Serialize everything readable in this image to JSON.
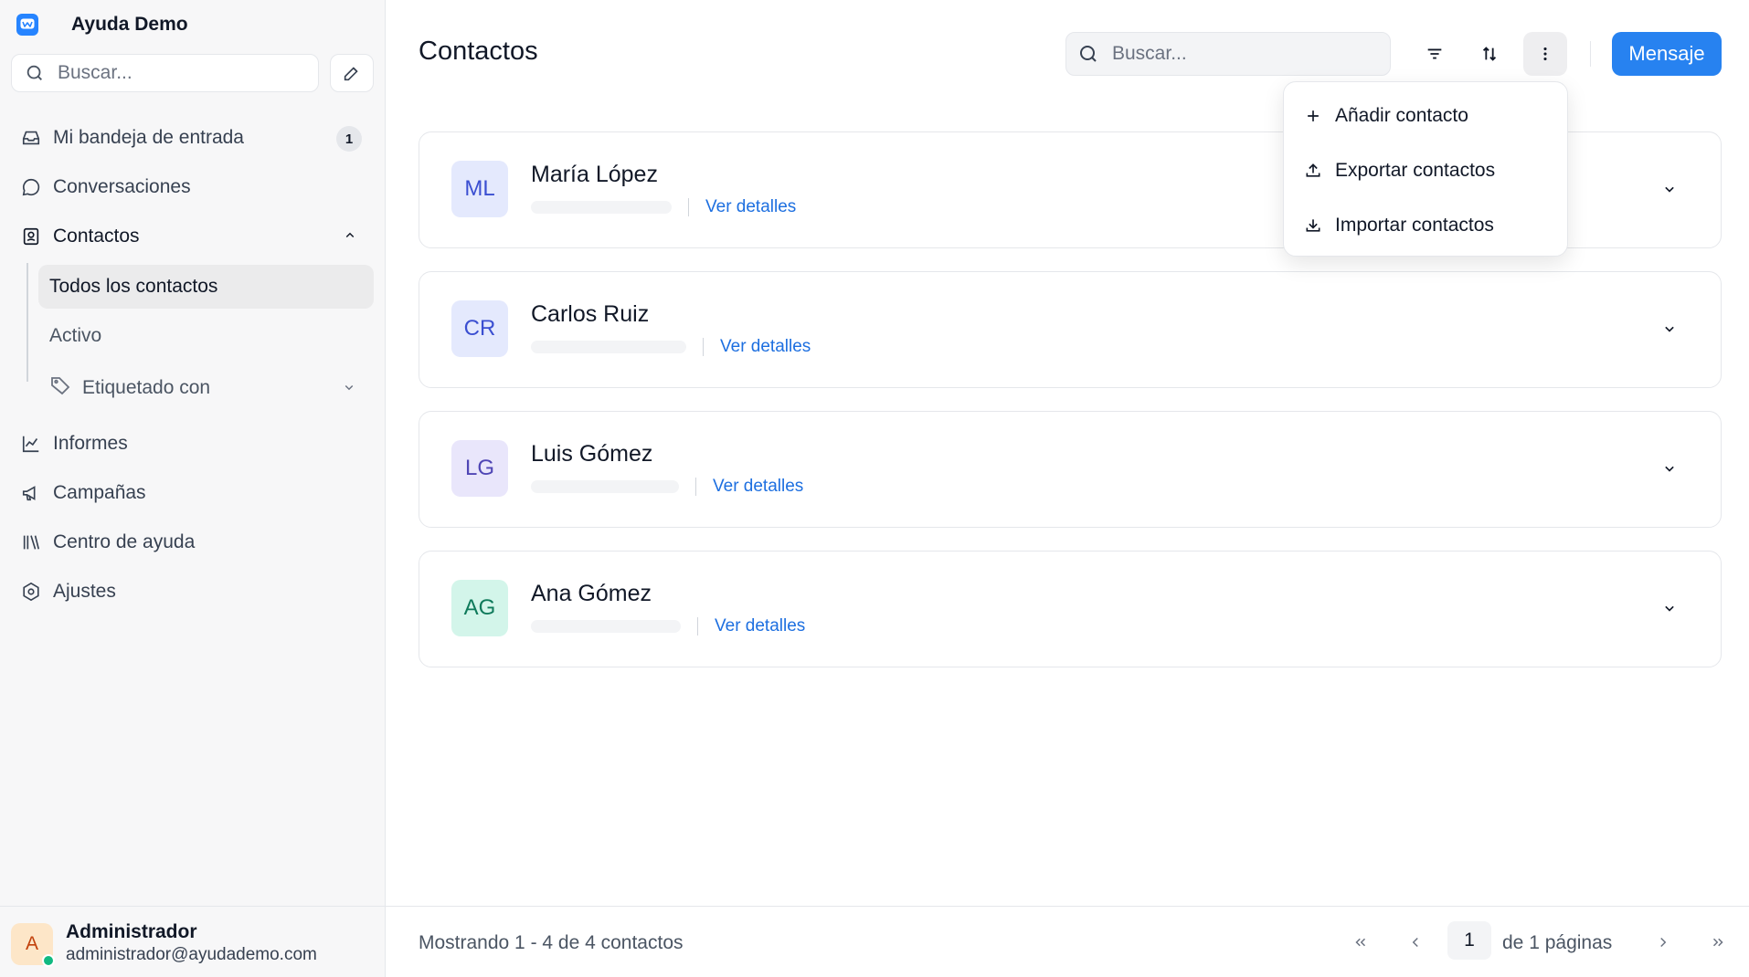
{
  "sidebar": {
    "brand": "Ayuda Demo",
    "search_placeholder": "Buscar...",
    "nav": {
      "inbox": {
        "label": "Mi bandeja de entrada",
        "badge": "1"
      },
      "conversations": {
        "label": "Conversaciones"
      },
      "contacts": {
        "label": "Contactos"
      },
      "all_contacts": {
        "label": "Todos los contactos"
      },
      "active": {
        "label": "Activo"
      },
      "tagged": {
        "label": "Etiquetado con"
      },
      "reports": {
        "label": "Informes"
      },
      "campaigns": {
        "label": "Campañas"
      },
      "help_center": {
        "label": "Centro de ayuda"
      },
      "settings": {
        "label": "Ajustes"
      }
    },
    "user": {
      "initial": "A",
      "name": "Administrador",
      "email": "administrador@ayudademo.com"
    }
  },
  "main": {
    "title": "Contactos",
    "search_placeholder": "Buscar...",
    "message_button": "Mensaje",
    "contacts": [
      {
        "initials": "ML",
        "name": "María López",
        "link": "Ver detalles",
        "avatar_bg": "#e4e9fd",
        "avatar_fg": "#3b4fd1"
      },
      {
        "initials": "CR",
        "name": "Carlos Ruiz",
        "link": "Ver detalles",
        "avatar_bg": "#e4e9fd",
        "avatar_fg": "#3b4fd1"
      },
      {
        "initials": "LG",
        "name": "Luis Gómez",
        "link": "Ver detalles",
        "avatar_bg": "#e9e6fb",
        "avatar_fg": "#4f46b5"
      },
      {
        "initials": "AG",
        "name": "Ana Gómez",
        "link": "Ver detalles",
        "avatar_bg": "#d3f5ea",
        "avatar_fg": "#0f7a5b"
      }
    ],
    "menu": {
      "add": "Añadir contacto",
      "export": "Exportar contactos",
      "import": "Importar contactos"
    },
    "footer": {
      "showing": "Mostrando 1 - 4 de 4 contactos",
      "current_page": "1",
      "total": "de 1 páginas"
    }
  },
  "colors": {
    "primary": "#2782f0",
    "link": "#1d6fe0",
    "online": "#10b981"
  },
  "icons": [
    "logo-icon",
    "search-icon",
    "compose-icon",
    "inbox-icon",
    "chat-icon",
    "contact-card-icon",
    "chevron-up-icon",
    "tag-icon",
    "chevron-down-icon",
    "chart-icon",
    "megaphone-icon",
    "library-icon",
    "settings-icon",
    "filter-icon",
    "sort-icon",
    "more-vertical-icon",
    "plus-icon",
    "upload-icon",
    "download-icon",
    "chevrons-left-icon",
    "chevron-left-icon",
    "chevron-right-icon",
    "chevrons-right-icon"
  ]
}
